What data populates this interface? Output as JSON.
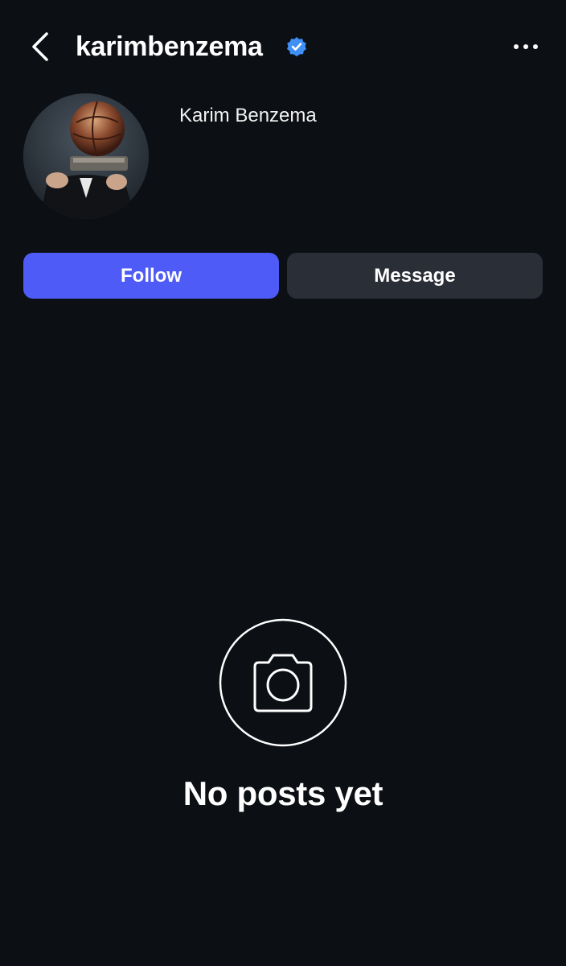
{
  "header": {
    "username": "karimbenzema",
    "verified": true,
    "back_icon": "chevron-left-icon",
    "more_icon": "more-horizontal-icon"
  },
  "profile": {
    "display_name": "Karim Benzema",
    "avatar_description": "avatar-photo"
  },
  "actions": {
    "follow_label": "Follow",
    "message_label": "Message"
  },
  "empty_state": {
    "icon": "camera-icon",
    "text": "No posts yet"
  },
  "colors": {
    "background": "#0c0f14",
    "follow_button": "#4e5bf6",
    "message_button": "#2a2e36",
    "verified_badge": "#3f8ff5"
  }
}
